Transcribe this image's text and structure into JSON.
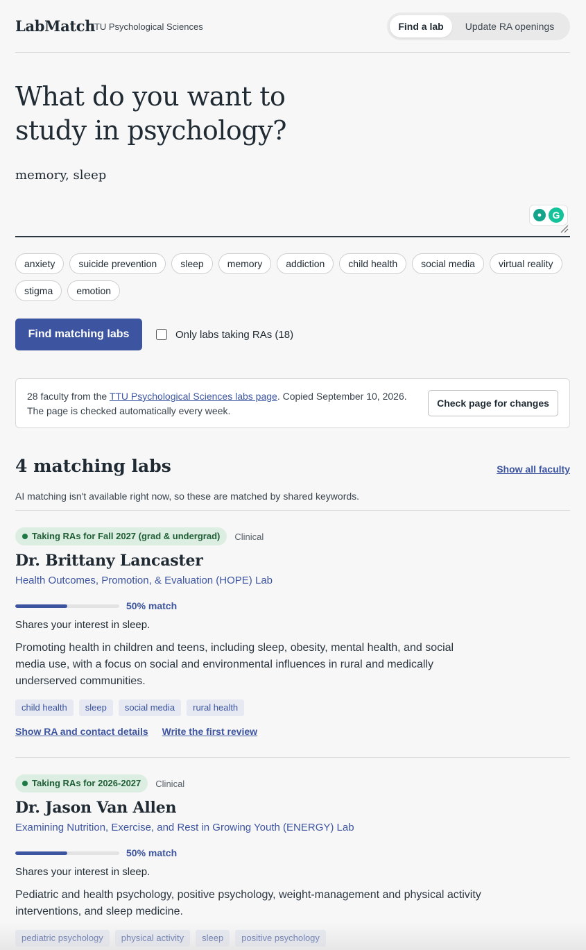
{
  "header": {
    "brand": "LabMatch",
    "brand_sub": "TTU Psychological Sciences",
    "tabs": [
      {
        "label": "Find a lab",
        "active": true
      },
      {
        "label": "Update RA openings",
        "active": false
      }
    ]
  },
  "hero": {
    "title": "What do you want to study in psychology?",
    "query_value": "memory, sleep"
  },
  "chips": [
    "anxiety",
    "suicide prevention",
    "sleep",
    "memory",
    "addiction",
    "child health",
    "social media",
    "virtual reality",
    "stigma",
    "emotion"
  ],
  "actions": {
    "primary_label": "Find matching labs",
    "checkbox_label": "Only labs taking RAs (18)"
  },
  "info": {
    "text_before": "28 faculty from the ",
    "link_text": "TTU Psychological Sciences labs page",
    "text_after": ". Copied September 10, 2026. The page is checked automatically every week.",
    "button_label": "Check page for changes"
  },
  "results": {
    "title": "4 matching labs",
    "show_all": "Show all faculty",
    "note": "AI matching isn't available right now, so these are matched by shared keywords."
  },
  "cards": [
    {
      "badge": "Taking RAs for Fall 2027 (grad & undergrad)",
      "area": "Clinical",
      "name": "Dr. Brittany Lancaster",
      "lab": "Health Outcomes, Promotion, & Evaluation (HOPE) Lab",
      "match_percent": 50,
      "match_label": "50% match",
      "shares": "Shares your interest in sleep.",
      "description": "Promoting health in children and teens, including sleep, obesity, mental health, and social media use, with a focus on social and environmental influences in rural and medically underserved communities.",
      "tags": [
        "child health",
        "sleep",
        "social media",
        "rural health"
      ],
      "links": [
        "Show RA and contact details",
        "Write the first review"
      ]
    },
    {
      "badge": "Taking RAs for 2026-2027",
      "area": "Clinical",
      "name": "Dr. Jason Van Allen",
      "lab": "Examining Nutrition, Exercise, and Rest in Growing Youth (ENERGY) Lab",
      "match_percent": 50,
      "match_label": "50% match",
      "shares": "Shares your interest in sleep.",
      "description": "Pediatric and health psychology, positive psychology, weight-management and physical activity interventions, and sleep medicine.",
      "tags": [
        "pediatric psychology",
        "physical activity",
        "sleep",
        "positive psychology"
      ],
      "links": []
    }
  ]
}
